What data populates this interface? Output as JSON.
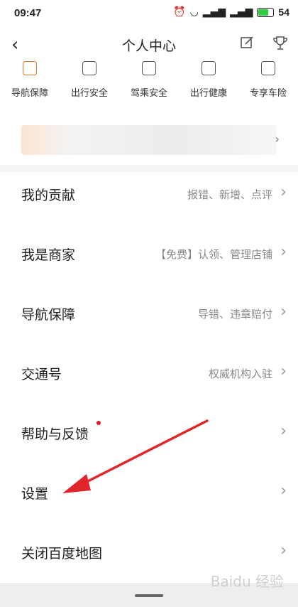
{
  "status_bar": {
    "time": "09:47",
    "battery": "54"
  },
  "header": {
    "title": "个人中心",
    "back_icon": "chevron-left-icon",
    "edit_icon": "edit-icon",
    "trophy_icon": "trophy-icon"
  },
  "quick_items": [
    {
      "label": "导航保障"
    },
    {
      "label": "出行安全"
    },
    {
      "label": "驾乘安全"
    },
    {
      "label": "出行健康"
    },
    {
      "label": "专享车险"
    }
  ],
  "menu": [
    {
      "label": "我的贡献",
      "sub": "报错、新增、点评"
    },
    {
      "label": "我是商家",
      "sub": "【免费】认领、管理店铺"
    },
    {
      "label": "导航保障",
      "sub": "导错、违章赔付"
    },
    {
      "label": "交通号",
      "sub": "权威机构入驻"
    },
    {
      "label": "帮助与反馈",
      "sub": ""
    },
    {
      "label": "设置",
      "sub": ""
    },
    {
      "label": "关闭百度地图",
      "sub": ""
    }
  ],
  "watermark": "Baidu 经验",
  "colors": {
    "notification_dot": "#e02020",
    "annotation_arrow": "#e0262a"
  }
}
